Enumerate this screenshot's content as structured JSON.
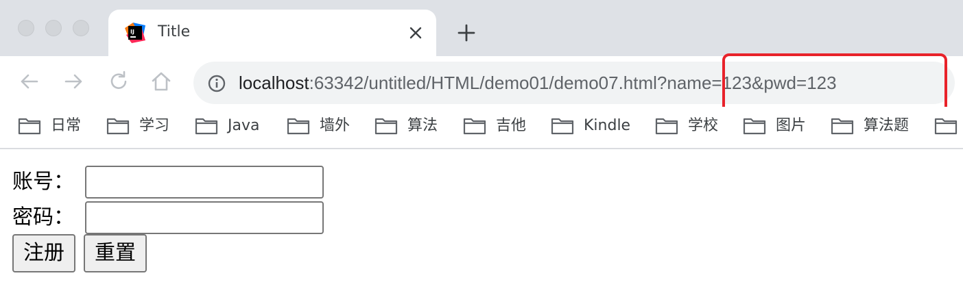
{
  "tab": {
    "title": "Title"
  },
  "address": {
    "host": "localhost",
    "rest": ":63342/untitled/HTML/demo01/demo07.html?name=123&pwd=123"
  },
  "bookmarks": [
    "日常",
    "学习",
    "Java",
    "墙外",
    "算法",
    "吉他",
    "Kindle",
    "学校",
    "图片",
    "算法题"
  ],
  "form": {
    "account_label": "账号：",
    "password_label": "密码：",
    "account_value": "",
    "password_value": "",
    "submit_label": "注册",
    "reset_label": "重置"
  },
  "colors": {
    "highlight": "#e8222a",
    "tabstrip": "#dee1e6",
    "omnibox": "#f1f3f4"
  },
  "icons": [
    "intellij-favicon-icon",
    "close-icon",
    "plus-icon",
    "back-arrow-icon",
    "forward-arrow-icon",
    "reload-icon",
    "home-icon",
    "info-icon",
    "folder-icon"
  ]
}
